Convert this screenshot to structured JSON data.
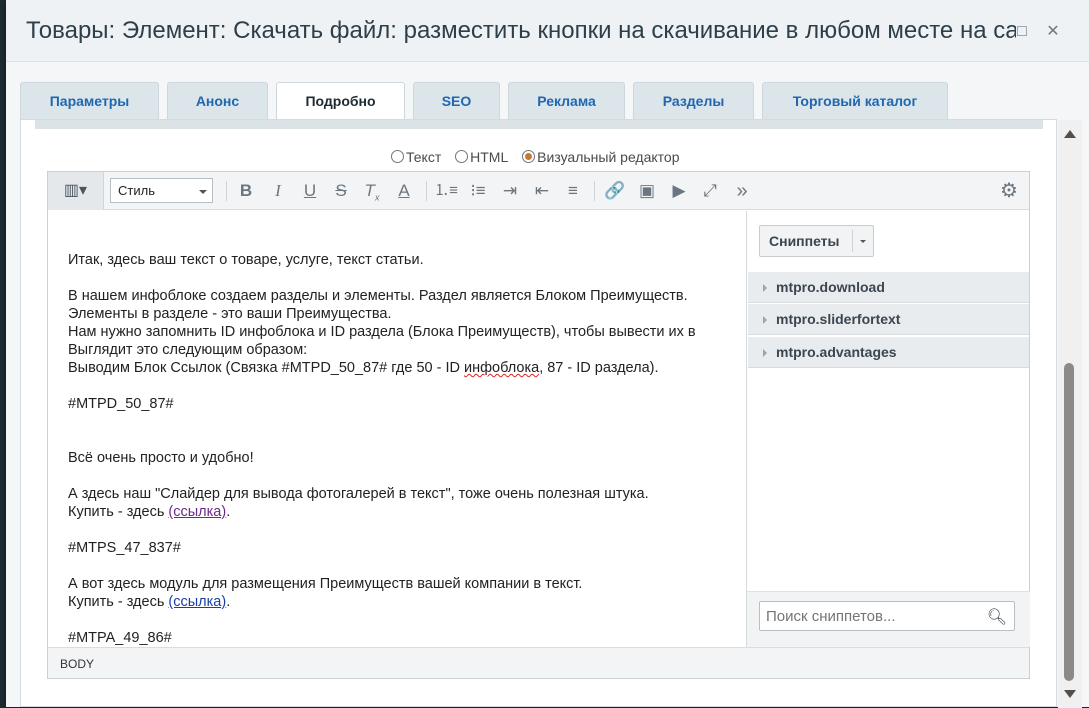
{
  "window": {
    "title": "Товары: Элемент: Скачать файл: разместить кнопки на скачивание в любом месте на сайте -",
    "maximize_icon": "□",
    "close_icon": "✕"
  },
  "tabs": [
    {
      "label": "Параметры"
    },
    {
      "label": "Анонс"
    },
    {
      "label": "Подробно"
    },
    {
      "label": "SEO"
    },
    {
      "label": "Реклама"
    },
    {
      "label": "Разделы"
    },
    {
      "label": "Торговый каталог"
    }
  ],
  "mode": {
    "options": [
      "Текст",
      "HTML",
      "Визуальный редактор"
    ],
    "selected": "Визуальный редактор"
  },
  "toolbar": {
    "style_label": "Стиль"
  },
  "content": {
    "line1": "Итак, здесь ваш текст о товаре, услуге, текст статьи.",
    "line2": "В нашем инфоблоке создаем разделы и элементы. Раздел является Блоком Преимуществ.",
    "line3": "Элементы в разделе - это ваши Преимущества.",
    "line4": "Нам нужно запомнить ID инфоблока и ID раздела (Блока Преимуществ), чтобы вывести их в",
    "line5": "Выглядит это следующим образом:",
    "line6_a": "Выводим Блок Ссылок (Связка #MTPD_50_87# где 50 - ID ",
    "line6_b": "инфоблока",
    "line6_c": ", 87 - ID раздела).",
    "code1": "#MTPD_50_87#",
    "line7": "Всё очень просто и удобно!",
    "line8": "А здесь наш \"Слайдер для вывода фотогалерей в текст\", тоже очень полезная штука.",
    "buy1_a": "Купить - здесь ",
    "buy1_link": "(ссылка)",
    "buy1_b": ".",
    "code2": "#MTPS_47_837#",
    "line9": "А вот здесь модуль для размещения Преимуществ вашей компании в текст.",
    "buy2_a": "Купить - здесь ",
    "buy2_link": "(ссылка)",
    "buy2_b": ".",
    "code3": "#MTPA_49_86#"
  },
  "snippets": {
    "button_label": "Сниппеты",
    "items": [
      {
        "label": "mtpro.download"
      },
      {
        "label": "mtpro.sliderfortext"
      },
      {
        "label": "mtpro.advantages"
      }
    ],
    "search_placeholder": "Поиск сниппетов..."
  },
  "statusbar": {
    "path": "BODY"
  }
}
